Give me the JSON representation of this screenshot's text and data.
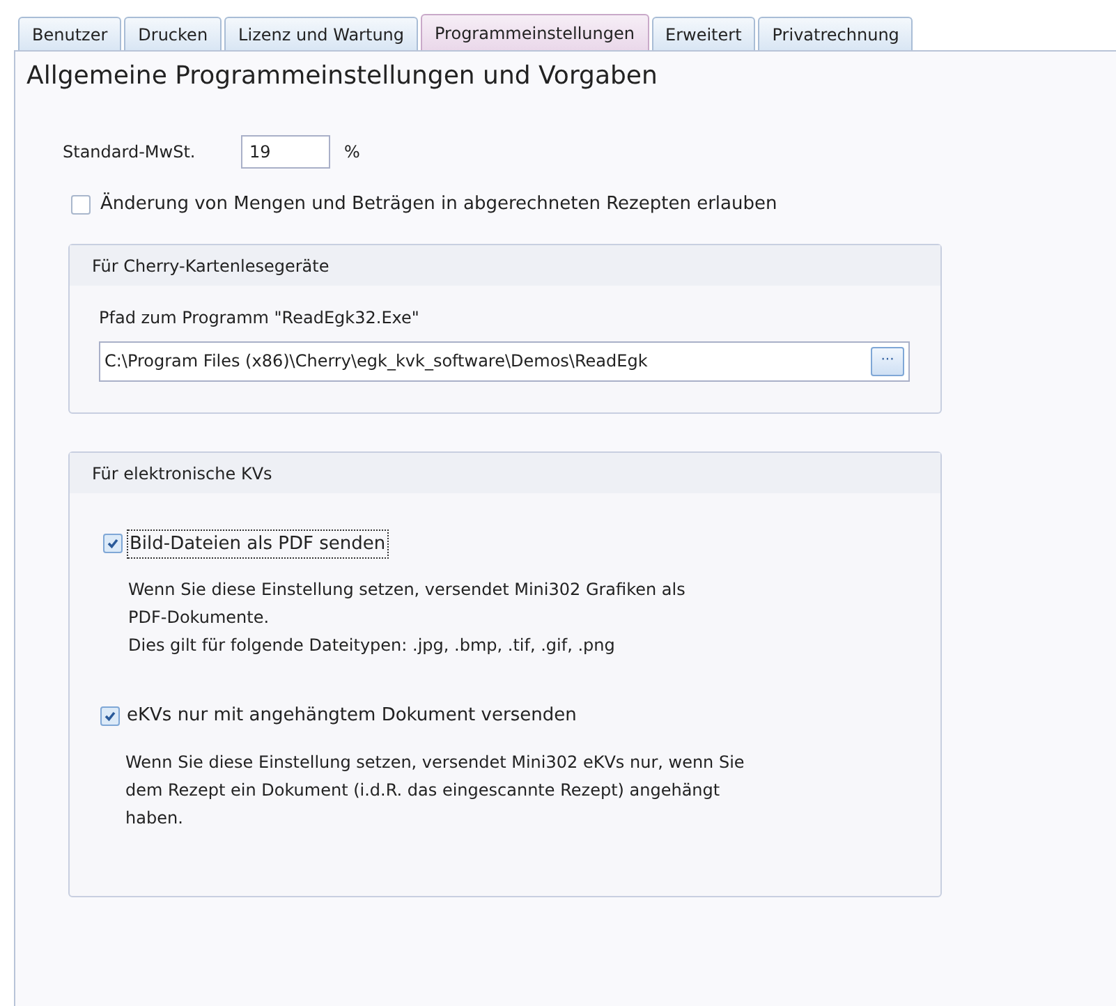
{
  "tabs": [
    {
      "label": "Benutzer",
      "selected": false
    },
    {
      "label": "Drucken",
      "selected": false
    },
    {
      "label": "Lizenz und Wartung",
      "selected": false
    },
    {
      "label": "Programmeinstellungen",
      "selected": true
    },
    {
      "label": "Erweitert",
      "selected": false
    },
    {
      "label": "Privatrechnung",
      "selected": false
    }
  ],
  "heading": "Allgemeine Programmeinstellungen und Vorgaben",
  "vat": {
    "label": "Standard-MwSt.",
    "value": "19",
    "unit": "%"
  },
  "allow_changes": {
    "label": "Änderung von Mengen und Beträgen in abgerechneten Rezepten erlauben",
    "checked": false
  },
  "cherry_group": {
    "title": "Für Cherry-Kartenlesegeräte",
    "path_label": "Pfad zum Programm \"ReadEgk32.Exe\"",
    "path_value": "C:\\Program Files (x86)\\Cherry\\egk_kvk_software\\Demos\\ReadEgk",
    "browse": "···"
  },
  "ekv_group": {
    "title": "Für elektronische KVs",
    "options": [
      {
        "label": "Bild-Dateien als PDF senden",
        "checked": true,
        "focused": true,
        "description": [
          "Wenn Sie diese Einstellung setzen, versendet Mini302 Grafiken als",
          "PDF-Dokumente.",
          "Dies gilt für folgende Dateitypen: .jpg, .bmp, .tif, .gif, .png"
        ]
      },
      {
        "label": "eKVs nur mit angehängtem Dokument versenden",
        "checked": true,
        "focused": false,
        "description": [
          "Wenn Sie diese Einstellung setzen, versendet Mini302 eKVs nur, wenn Sie",
          "dem Rezept ein Dokument (i.d.R. das eingescannte Rezept) angehängt",
          "haben."
        ]
      }
    ]
  }
}
